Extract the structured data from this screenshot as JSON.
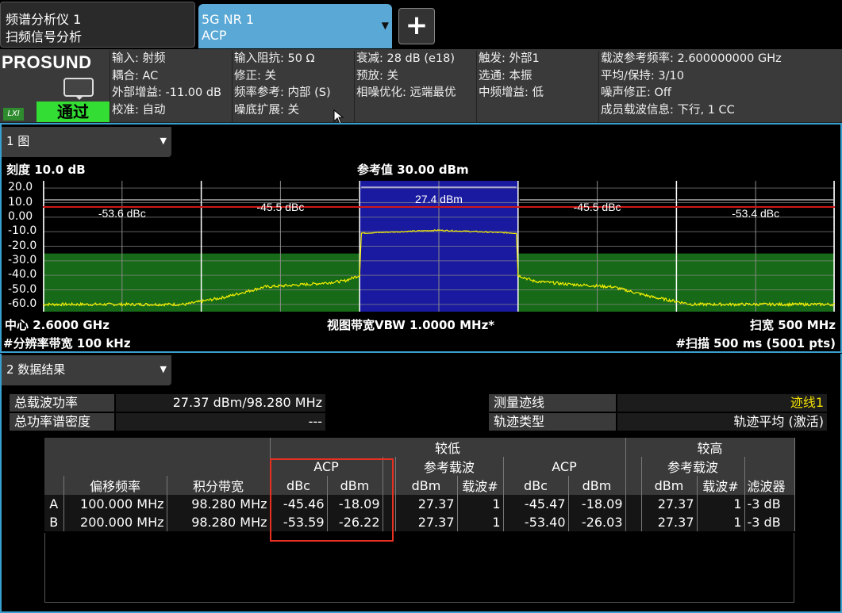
{
  "tabs": {
    "tab1_line1": "频谱分析仪 1",
    "tab1_line2": "扫频信号分析",
    "tab2_line1": "5G NR 1",
    "tab2_line2": "ACP",
    "add_label": "+"
  },
  "brand": {
    "logo": "PROSUND",
    "lxi": "LXI",
    "status": "通过"
  },
  "info": {
    "col1": [
      "输入: 射频",
      "耦合: AC",
      "外部增益: -11.00 dB",
      "校准: 自动"
    ],
    "col2": [
      "输入阻抗: 50 Ω",
      "修正: 关",
      "频率参考: 内部 (S)",
      "噪底扩展: 关"
    ],
    "col3": [
      "衰减: 28 dB (e18)",
      "预放: 关",
      "相噪优化: 远端最优"
    ],
    "col4": [
      "触发: 外部1",
      "选通: 本振",
      "中频增益: 低"
    ],
    "col5": [
      "载波参考频率: 2.600000000 GHz",
      "平均/保持: 3/10",
      "噪声修正: Off",
      "成员载波信息: 下行, 1 CC"
    ]
  },
  "trace_panel": {
    "tab_label": "1 图",
    "scale": "刻度 10.0 dB",
    "ref_value": "参考值 30.00 dBm",
    "center": "中心 2.6000 GHz",
    "rbw": "#分辨率带宽 100 kHz",
    "vbw": "视图带宽VBW 1.0000 MHz*",
    "span": "扫宽 500 MHz",
    "sweep": "#扫描 500 ms  (5001 pts)"
  },
  "chart_data": {
    "type": "line",
    "y_ticks": [
      "20.0",
      "10.0",
      "0.00",
      "-10.0",
      "-20.0",
      "-30.0",
      "-40.0",
      "-50.0",
      "-60.0"
    ],
    "ylim": [
      -65,
      25
    ],
    "xlim_mhz": [
      -250,
      250
    ],
    "red_limit_dbm": 7,
    "limit_mask_dbm": -25,
    "carrier_label": "27.4 dBm",
    "band_labels": [
      "-53.6 dBc",
      "-45.5 dBc",
      "-45.5 dBc",
      "-53.4 dBc"
    ],
    "band_edges_mhz": [
      -250,
      -150,
      -50,
      50,
      150,
      250
    ],
    "trace_points": {
      "x_mhz": [
        -250,
        -160,
        -135,
        -110,
        -80,
        -60,
        -50,
        -49,
        0,
        49,
        50,
        60,
        80,
        110,
        135,
        160,
        250
      ],
      "y_dbm": [
        -60,
        -60,
        -55,
        -48,
        -46,
        -44,
        -40,
        -11,
        -9,
        -11,
        -40,
        -44,
        -46,
        -48,
        -55,
        -60,
        -60
      ]
    },
    "colors": {
      "trace": "#f5f000",
      "limit": "#d01818",
      "mask_fill": "#176a17",
      "carrier_fill": "#1a1aa0"
    }
  },
  "results_panel": {
    "tab_label": "2 数据结果",
    "total_power_label": "总载波功率",
    "total_power_value": "27.37 dBm/98.280 MHz",
    "psd_label": "总功率谱密度",
    "psd_value": "---",
    "trace_label": "测量迹线",
    "trace_value": "迹线1",
    "trace_type_label": "轨迹类型",
    "trace_type_value": "轨迹平均 (激活)"
  },
  "acp_table": {
    "group_low": "较低",
    "group_high": "较高",
    "acp": "ACP",
    "ref_carrier": "参考载波",
    "headers": [
      "偏移频率",
      "积分带宽",
      "dBc",
      "dBm",
      "dBm",
      "载波#",
      "dBc",
      "dBm",
      "dBm",
      "载波#",
      "滤波器"
    ],
    "rows": [
      [
        "A",
        "100.000 MHz",
        "98.280 MHz",
        "-45.46",
        "-18.09",
        "27.37",
        "1",
        "-45.47",
        "-18.09",
        "27.37",
        "1",
        "-3 dB"
      ],
      [
        "B",
        "200.000 MHz",
        "98.280 MHz",
        "-53.59",
        "-26.22",
        "27.37",
        "1",
        "-53.40",
        "-26.03",
        "27.37",
        "1",
        "-3 dB"
      ]
    ]
  }
}
